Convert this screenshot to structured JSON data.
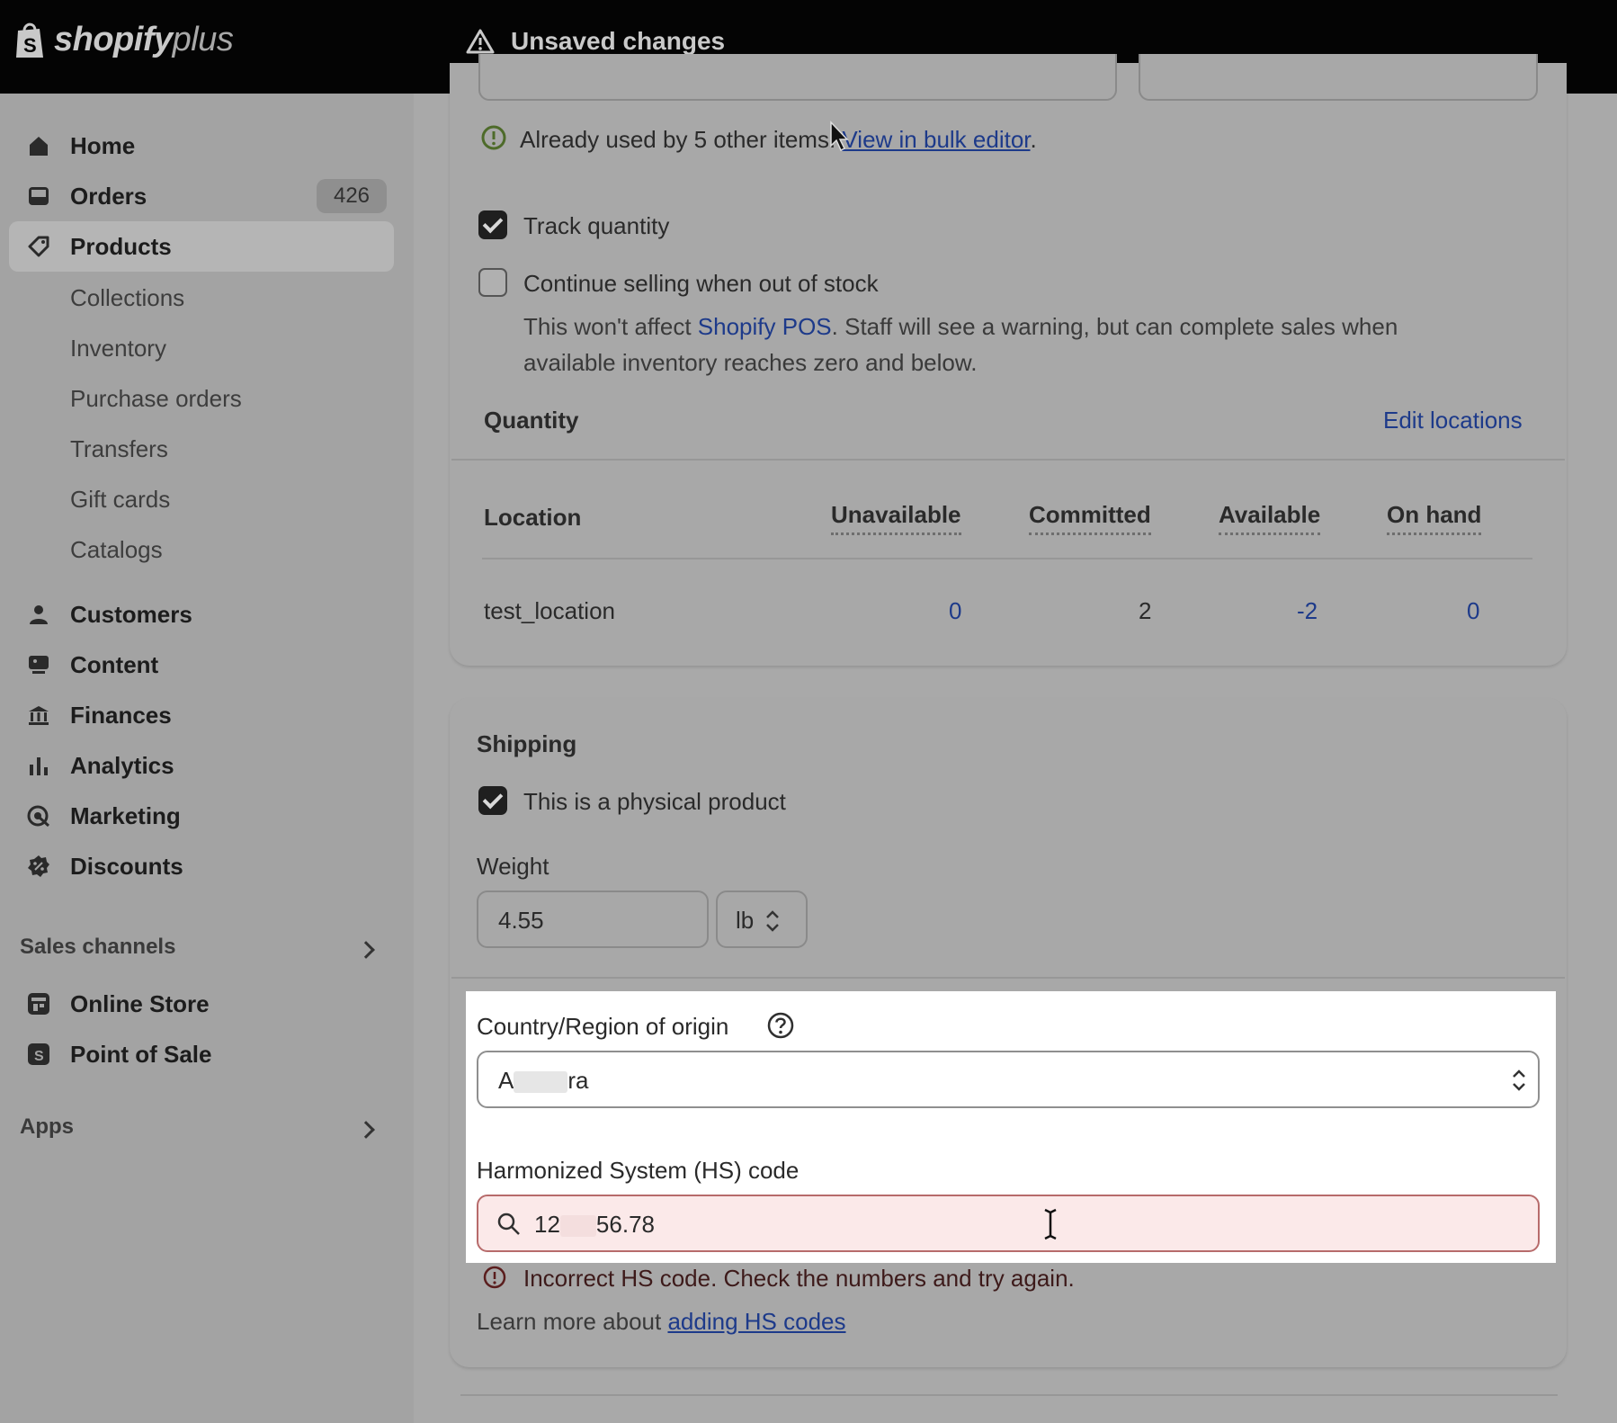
{
  "topbar": {
    "brand": "shopify",
    "brand_suffix": "plus",
    "status": "Unsaved changes"
  },
  "sidebar": {
    "home": "Home",
    "orders": "Orders",
    "orders_count": "426",
    "products": "Products",
    "sub": [
      "Collections",
      "Inventory",
      "Purchase orders",
      "Transfers",
      "Gift cards",
      "Catalogs"
    ],
    "customers": "Customers",
    "content": "Content",
    "finances": "Finances",
    "analytics": "Analytics",
    "marketing": "Marketing",
    "discounts": "Discounts",
    "sales_channels": "Sales channels",
    "online_store": "Online Store",
    "point_of_sale": "Point of Sale",
    "apps": "Apps"
  },
  "inventory": {
    "sku_notice_prefix": "Already used by 5 other items.",
    "sku_notice_link": "View in bulk editor",
    "sku_notice_suffix": ".",
    "track_quantity": "Track quantity",
    "continue_selling": "Continue selling when out of stock",
    "pos_note_prefix": "This won't affect ",
    "pos_note_link": "Shopify POS",
    "pos_note_line1_rest": ". Staff will see a warning, but can complete sales when",
    "pos_note_line2": "available inventory reaches zero and below.",
    "quantity_title": "Quantity",
    "edit_locations": "Edit locations",
    "table": {
      "headers": [
        "Location",
        "Unavailable",
        "Committed",
        "Available",
        "On hand"
      ],
      "rows": [
        {
          "location": "test_location",
          "unavailable": "0",
          "committed": "2",
          "available": "-2",
          "on_hand": "0"
        }
      ]
    }
  },
  "shipping": {
    "title": "Shipping",
    "physical_product": "This is a physical product",
    "weight_label": "Weight",
    "weight_value": "4.55",
    "weight_unit": "lb",
    "country_label": "Country/Region of origin",
    "country_value_start": "A",
    "country_value_end": "ra",
    "hs_label": "Harmonized System (HS) code",
    "hs_value_start": "12",
    "hs_value_end": "56.78",
    "hs_error": "Incorrect HS code. Check the numbers and try again.",
    "learn_more_prefix": "Learn more about ",
    "learn_more_link": "adding HS codes"
  },
  "colors": {
    "overlay_bg": "#a9a9a9",
    "link": "#1d3a8a",
    "error_bg": "#fbe9e9"
  }
}
